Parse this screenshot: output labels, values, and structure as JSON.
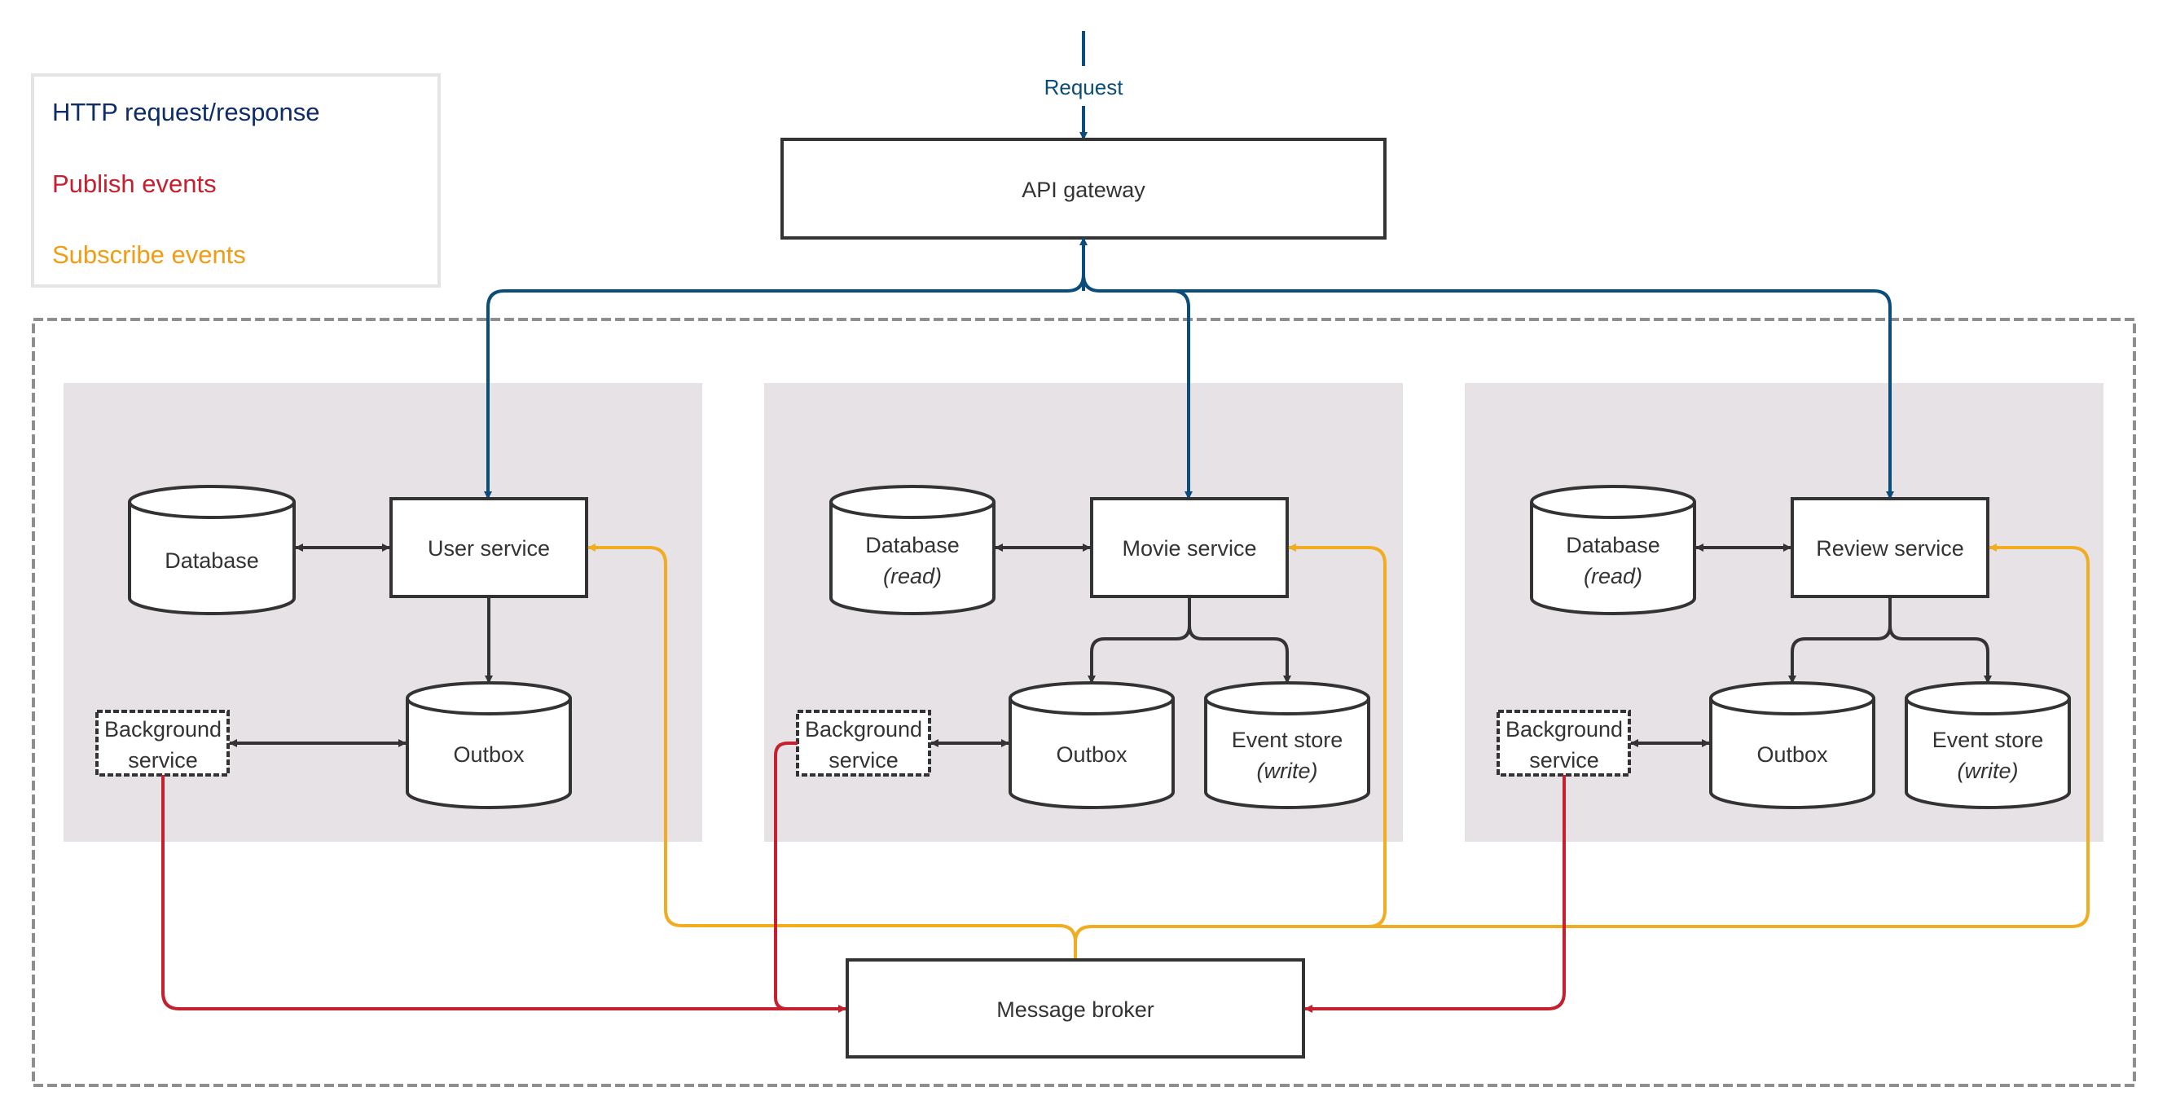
{
  "legend": {
    "items": [
      {
        "label": "HTTP request/response",
        "color": "#0e2c6a"
      },
      {
        "label": "Publish events",
        "color": "#c4202f"
      },
      {
        "label": "Subscribe events",
        "color": "#f19c12"
      }
    ]
  },
  "colors": {
    "http": "#0b4d7a",
    "publish": "#c4202f",
    "subscribe": "#f0ad22",
    "internal": "#333333",
    "panel": "#e6e2e6",
    "boundary": "#8e8e8e"
  },
  "entry": {
    "label": "Request"
  },
  "gateway": {
    "label": "API gateway"
  },
  "broker": {
    "label": "Message broker"
  },
  "services": [
    {
      "name": "User service",
      "database": {
        "label": "Database",
        "sub": ""
      },
      "outbox": {
        "label": "Outbox"
      },
      "event_store": null,
      "background": {
        "line1": "Background",
        "line2": "service"
      }
    },
    {
      "name": "Movie service",
      "database": {
        "label": "Database",
        "sub": "(read)"
      },
      "outbox": {
        "label": "Outbox"
      },
      "event_store": {
        "label": "Event store",
        "sub": "(write)"
      },
      "background": {
        "line1": "Background",
        "line2": "service"
      }
    },
    {
      "name": "Review service",
      "database": {
        "label": "Database",
        "sub": "(read)"
      },
      "outbox": {
        "label": "Outbox"
      },
      "event_store": {
        "label": "Event store",
        "sub": "(write)"
      },
      "background": {
        "line1": "Background",
        "line2": "service"
      }
    }
  ]
}
